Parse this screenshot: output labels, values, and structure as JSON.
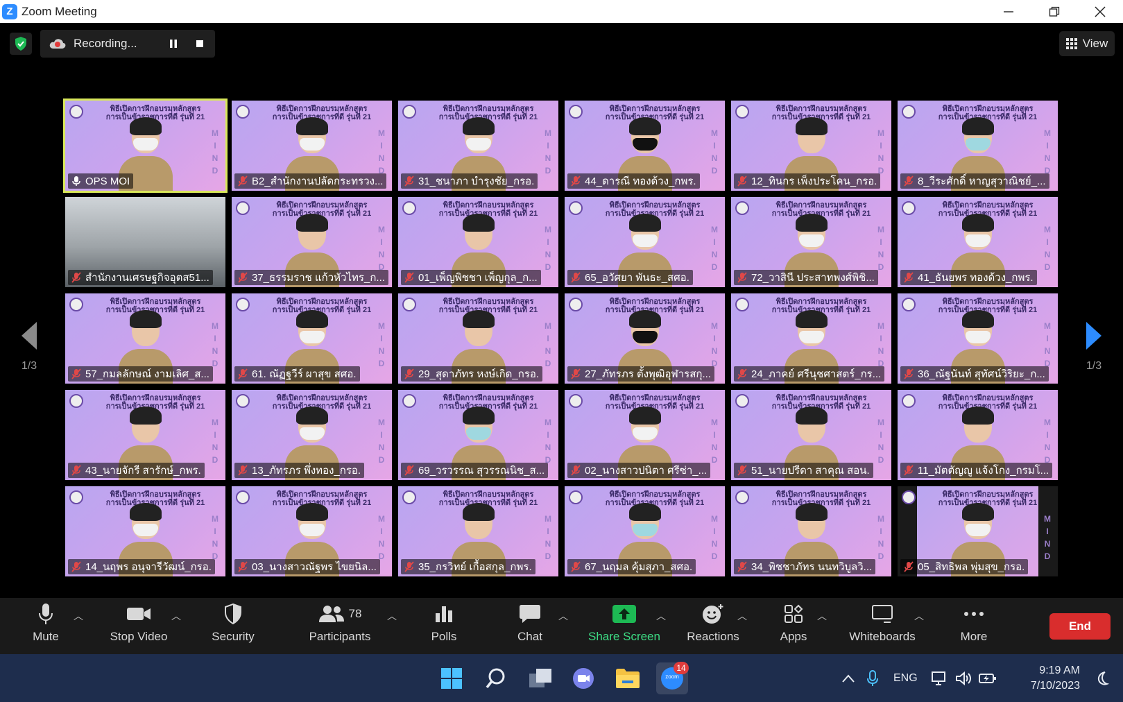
{
  "window": {
    "title": "Zoom Meeting"
  },
  "recording": {
    "label": "Recording..."
  },
  "view_button": {
    "label": "View"
  },
  "pager": {
    "left": "1/3",
    "right": "1/3"
  },
  "participants": [
    {
      "name": "OPS MOI",
      "kind": "speaker",
      "mask": "white"
    },
    {
      "name": "B2_สำนักงานปลัดกระทรวง...",
      "kind": "normal",
      "mask": "white"
    },
    {
      "name": "31_ชนาภา บำรุงชัย_กรอ.",
      "kind": "normal",
      "mask": "white"
    },
    {
      "name": "44_ดารณี ทองด้วง_กพร.",
      "kind": "normal",
      "mask": "black"
    },
    {
      "name": "12_ทินกร เพ็งประโคน_กรอ.",
      "kind": "normal",
      "mask": "none"
    },
    {
      "name": "8_วีระศักดิ์ หาญสุวาณิชย์_...",
      "kind": "normal",
      "mask": "blue"
    },
    {
      "name": "สำนักงานเศรษฐกิจอุตส51...",
      "kind": "room",
      "mask": "none"
    },
    {
      "name": "37_ธรรมราช แก้วหัวไทร_ก...",
      "kind": "normal",
      "mask": "none"
    },
    {
      "name": "01_เพ็ญพิชชา เพ็ญกุล_ก...",
      "kind": "normal",
      "mask": "none"
    },
    {
      "name": "65_อวัศยา พันธะ_สศอ.",
      "kind": "normal",
      "mask": "white"
    },
    {
      "name": "72_วาสินี ประสาทพงศ์พิชิ...",
      "kind": "normal",
      "mask": "white"
    },
    {
      "name": "41_ธันยพร ทองด้วง_กพร.",
      "kind": "normal",
      "mask": "white"
    },
    {
      "name": "57_กมลลักษณ์ งามเลิศ_ส...",
      "kind": "normal",
      "mask": "none"
    },
    {
      "name": "61. ณัฏฐวีร์ ผาสุข สศอ.",
      "kind": "normal",
      "mask": "white"
    },
    {
      "name": "29_สุดาภัทร หงษ์เกิด_กรอ.",
      "kind": "normal",
      "mask": "none"
    },
    {
      "name": "27_ภัทรภร ตั้งพุฒิอุฬารสกุ...",
      "kind": "normal",
      "mask": "black"
    },
    {
      "name": "24_ภาคย์ ศรีนุชศาสตร์_กร...",
      "kind": "normal",
      "mask": "white"
    },
    {
      "name": "36_ณัฐนันท์ สุทัศน์วิริยะ_ก...",
      "kind": "normal",
      "mask": "white"
    },
    {
      "name": "43_นายจักรี สารักษ์_กพร.",
      "kind": "normal",
      "mask": "none"
    },
    {
      "name": "13_ภัทรภร พึ่งทอง_กรอ.",
      "kind": "normal",
      "mask": "white"
    },
    {
      "name": "69_วรวรรณ สุวรรณนิช_ส...",
      "kind": "normal",
      "mask": "blue"
    },
    {
      "name": "02_นางสาวปนิตา ศรีซ่า_...",
      "kind": "normal",
      "mask": "white"
    },
    {
      "name": "51_นายปรีดา สาคุณ สอน.",
      "kind": "normal",
      "mask": "none"
    },
    {
      "name": "11_มัตตัญญู แจ้งโกง_กรมโ...",
      "kind": "normal",
      "mask": "none"
    },
    {
      "name": "14_นฤพร อนุจารีวัฒน์_กรอ.",
      "kind": "normal",
      "mask": "white"
    },
    {
      "name": "03_นางสาวณัฐพร ไขยนิล...",
      "kind": "normal",
      "mask": "white"
    },
    {
      "name": "35_กรวิทย์ เกื้อสกุล_กพร.",
      "kind": "normal",
      "mask": "none"
    },
    {
      "name": "67_นฤมล คุ้มสุภา_สศอ.",
      "kind": "normal",
      "mask": "blue"
    },
    {
      "name": "34_พิชชาภัทร นนทวิบูลวิ...",
      "kind": "normal",
      "mask": "none"
    },
    {
      "name": "05_สิทธิพล พุ่มสุข_กรอ.",
      "kind": "dark",
      "mask": "white"
    }
  ],
  "banner": {
    "line1": "พิธีเปิดการฝึกอบรมหลักสูตร",
    "line2": "การเป็นข้าราชการที่ดี รุ่นที่ 21",
    "side": "M I N D"
  },
  "toolbar": {
    "mute": "Mute",
    "stop_video": "Stop Video",
    "security": "Security",
    "participants": "Participants",
    "participants_count": "78",
    "polls": "Polls",
    "chat": "Chat",
    "share_screen": "Share Screen",
    "reactions": "Reactions",
    "apps": "Apps",
    "whiteboards": "Whiteboards",
    "more": "More",
    "end": "End"
  },
  "taskbar": {
    "zoom_badge": "14",
    "zoom_label": "zoom",
    "language": "ENG",
    "time": "9:19 AM",
    "date": "7/10/2023"
  },
  "colors": {
    "share_green": "#3ddc84",
    "end_red": "#d92d2d",
    "active_speaker": "#d9e85a",
    "zoom_blue": "#2d8cff"
  }
}
